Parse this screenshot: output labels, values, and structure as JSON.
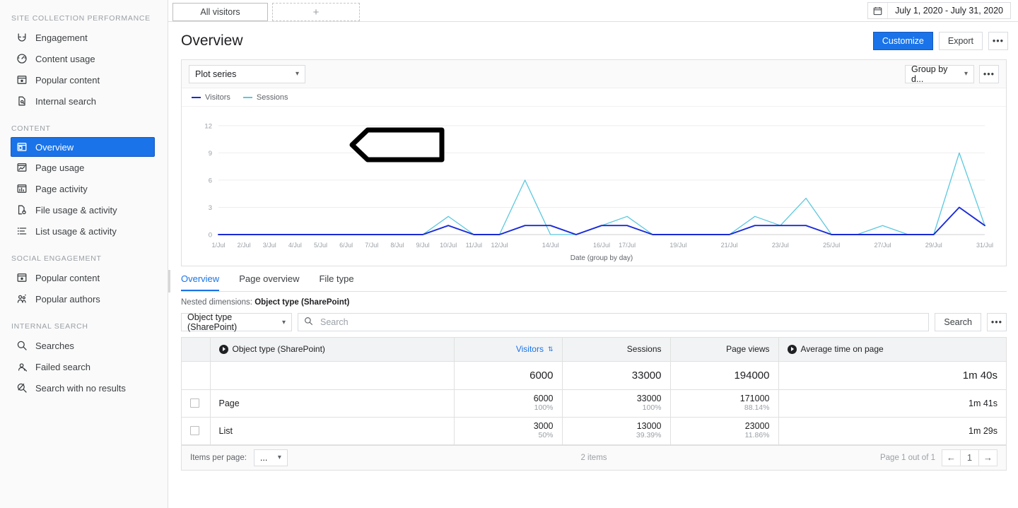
{
  "sidebar": {
    "groups": [
      {
        "title": "SITE COLLECTION PERFORMANCE",
        "items": [
          {
            "label": "Engagement",
            "icon": "magnet-icon",
            "selected": false
          },
          {
            "label": "Content usage",
            "icon": "gauge-icon",
            "selected": false
          },
          {
            "label": "Popular content",
            "icon": "popular-content-icon",
            "selected": false
          },
          {
            "label": "Internal search",
            "icon": "document-search-icon",
            "selected": false
          }
        ]
      },
      {
        "title": "CONTENT",
        "items": [
          {
            "label": "Overview",
            "icon": "overview-icon",
            "selected": true
          },
          {
            "label": "Page usage",
            "icon": "page-usage-icon",
            "selected": false
          },
          {
            "label": "Page activity",
            "icon": "page-activity-icon",
            "selected": false
          },
          {
            "label": "File usage & activity",
            "icon": "file-activity-icon",
            "selected": false
          },
          {
            "label": "List usage & activity",
            "icon": "list-activity-icon",
            "selected": false
          }
        ]
      },
      {
        "title": "SOCIAL ENGAGEMENT",
        "items": [
          {
            "label": "Popular content",
            "icon": "popular-content-icon",
            "selected": false
          },
          {
            "label": "Popular authors",
            "icon": "popular-authors-icon",
            "selected": false
          }
        ]
      },
      {
        "title": "INTERNAL SEARCH",
        "items": [
          {
            "label": "Searches",
            "icon": "search-icon",
            "selected": false
          },
          {
            "label": "Failed search",
            "icon": "failed-search-icon",
            "selected": false
          },
          {
            "label": "Search with no results",
            "icon": "no-results-search-icon",
            "selected": false
          }
        ]
      }
    ]
  },
  "segment_bar": {
    "tab_label": "All visitors",
    "add_label": "+"
  },
  "date_range": {
    "icon": "calendar-icon",
    "value": "July 1, 2020 - July 31, 2020"
  },
  "header": {
    "title": "Overview",
    "customize_label": "Customize",
    "export_label": "Export",
    "more_label": "•••"
  },
  "chart_toolbar": {
    "plot_series_label": "Plot series",
    "group_by_label": "Group by d...",
    "more_label": "•••"
  },
  "bottom_tabs": [
    {
      "label": "Overview",
      "active": true
    },
    {
      "label": "Page overview",
      "active": false
    },
    {
      "label": "File type",
      "active": false
    }
  ],
  "nested_dimensions": {
    "prefix": "Nested dimensions:",
    "value": "Object type (SharePoint)"
  },
  "search": {
    "dimension_label": "Object type (SharePoint)",
    "placeholder": "Search",
    "value": "",
    "button_label": "Search",
    "more_label": "•••"
  },
  "table": {
    "columns": [
      {
        "label": "Object type (SharePoint)",
        "has_dim_icon": true,
        "align": "left",
        "sorted": false
      },
      {
        "label": "Visitors",
        "has_dim_icon": false,
        "align": "right",
        "sorted": true
      },
      {
        "label": "Sessions",
        "has_dim_icon": false,
        "align": "right",
        "sorted": false
      },
      {
        "label": "Page views",
        "has_dim_icon": false,
        "align": "right",
        "sorted": false
      },
      {
        "label": "Average time on page",
        "has_dim_icon": true,
        "align": "left",
        "sorted": false
      }
    ],
    "total_row": {
      "visitors": "6000",
      "sessions": "33000",
      "page_views": "194000",
      "avg_time": "1m 40s"
    },
    "rows": [
      {
        "name": "Page",
        "visitors": "6000",
        "visitors_pct": "100%",
        "sessions": "33000",
        "sessions_pct": "100%",
        "page_views": "171000",
        "page_views_pct": "88.14%",
        "avg_time": "1m 41s"
      },
      {
        "name": "List",
        "visitors": "3000",
        "visitors_pct": "50%",
        "sessions": "13000",
        "sessions_pct": "39.39%",
        "page_views": "23000",
        "page_views_pct": "11.86%",
        "avg_time": "1m 29s"
      }
    ],
    "footer": {
      "items_per_page_label": "Items per page:",
      "items_per_page_value": "...",
      "items_count": "2 items",
      "page_label": "Page 1 out of 1",
      "prev_icon": "arrow-left-icon",
      "page_number": "1",
      "next_icon": "arrow-right-icon"
    }
  },
  "chart_data": {
    "type": "line",
    "title": "",
    "xlabel": "Date (group by day)",
    "ylabel": "",
    "ylim": [
      0,
      13
    ],
    "yticks": [
      0,
      3,
      6,
      9,
      12
    ],
    "grid": true,
    "legend_position": "top-left",
    "x": [
      "1/Jul",
      "2/Jul",
      "3/Jul",
      "4/Jul",
      "5/Jul",
      "6/Jul",
      "7/Jul",
      "8/Jul",
      "9/Jul",
      "10/Jul",
      "11/Jul",
      "12/Jul",
      "13/Jul",
      "14/Jul",
      "15/Jul",
      "16/Jul",
      "17/Jul",
      "18/Jul",
      "19/Jul",
      "20/Jul",
      "21/Jul",
      "22/Jul",
      "23/Jul",
      "24/Jul",
      "25/Jul",
      "26/Jul",
      "27/Jul",
      "28/Jul",
      "29/Jul",
      "30/Jul",
      "31/Jul"
    ],
    "xtick_labels": [
      "1/Jul",
      "2/Jul",
      "3/Jul",
      "4/Jul",
      "5/Jul",
      "6/Jul",
      "7/Jul",
      "8/Jul",
      "9/Jul",
      "10/Jul",
      "11/Jul",
      "12/Jul",
      "",
      "14/Jul",
      "",
      "16/Jul",
      "17/Jul",
      "",
      "19/Jul",
      "",
      "21/Jul",
      "",
      "23/Jul",
      "",
      "25/Jul",
      "",
      "27/Jul",
      "",
      "29/Jul",
      "",
      "31/Jul"
    ],
    "series": [
      {
        "name": "Visitors",
        "color": "#1a2bd6",
        "values": [
          0,
          0,
          0,
          0,
          0,
          0,
          0,
          0,
          0,
          1,
          0,
          0,
          1,
          1,
          0,
          1,
          1,
          0,
          0,
          0,
          0,
          1,
          1,
          1,
          0,
          0,
          0,
          0,
          0,
          3,
          1
        ]
      },
      {
        "name": "Sessions",
        "color": "#5bc8de",
        "values": [
          0,
          0,
          0,
          0,
          0,
          0,
          0,
          0,
          0,
          2,
          0,
          0,
          6,
          0,
          0,
          1,
          2,
          0,
          0,
          0,
          0,
          2,
          1,
          4,
          0,
          0,
          1,
          0,
          0,
          9,
          1
        ]
      }
    ]
  },
  "annotation": {
    "shape": "left-arrow-outline",
    "points_to": "sidebar-item-overview"
  }
}
